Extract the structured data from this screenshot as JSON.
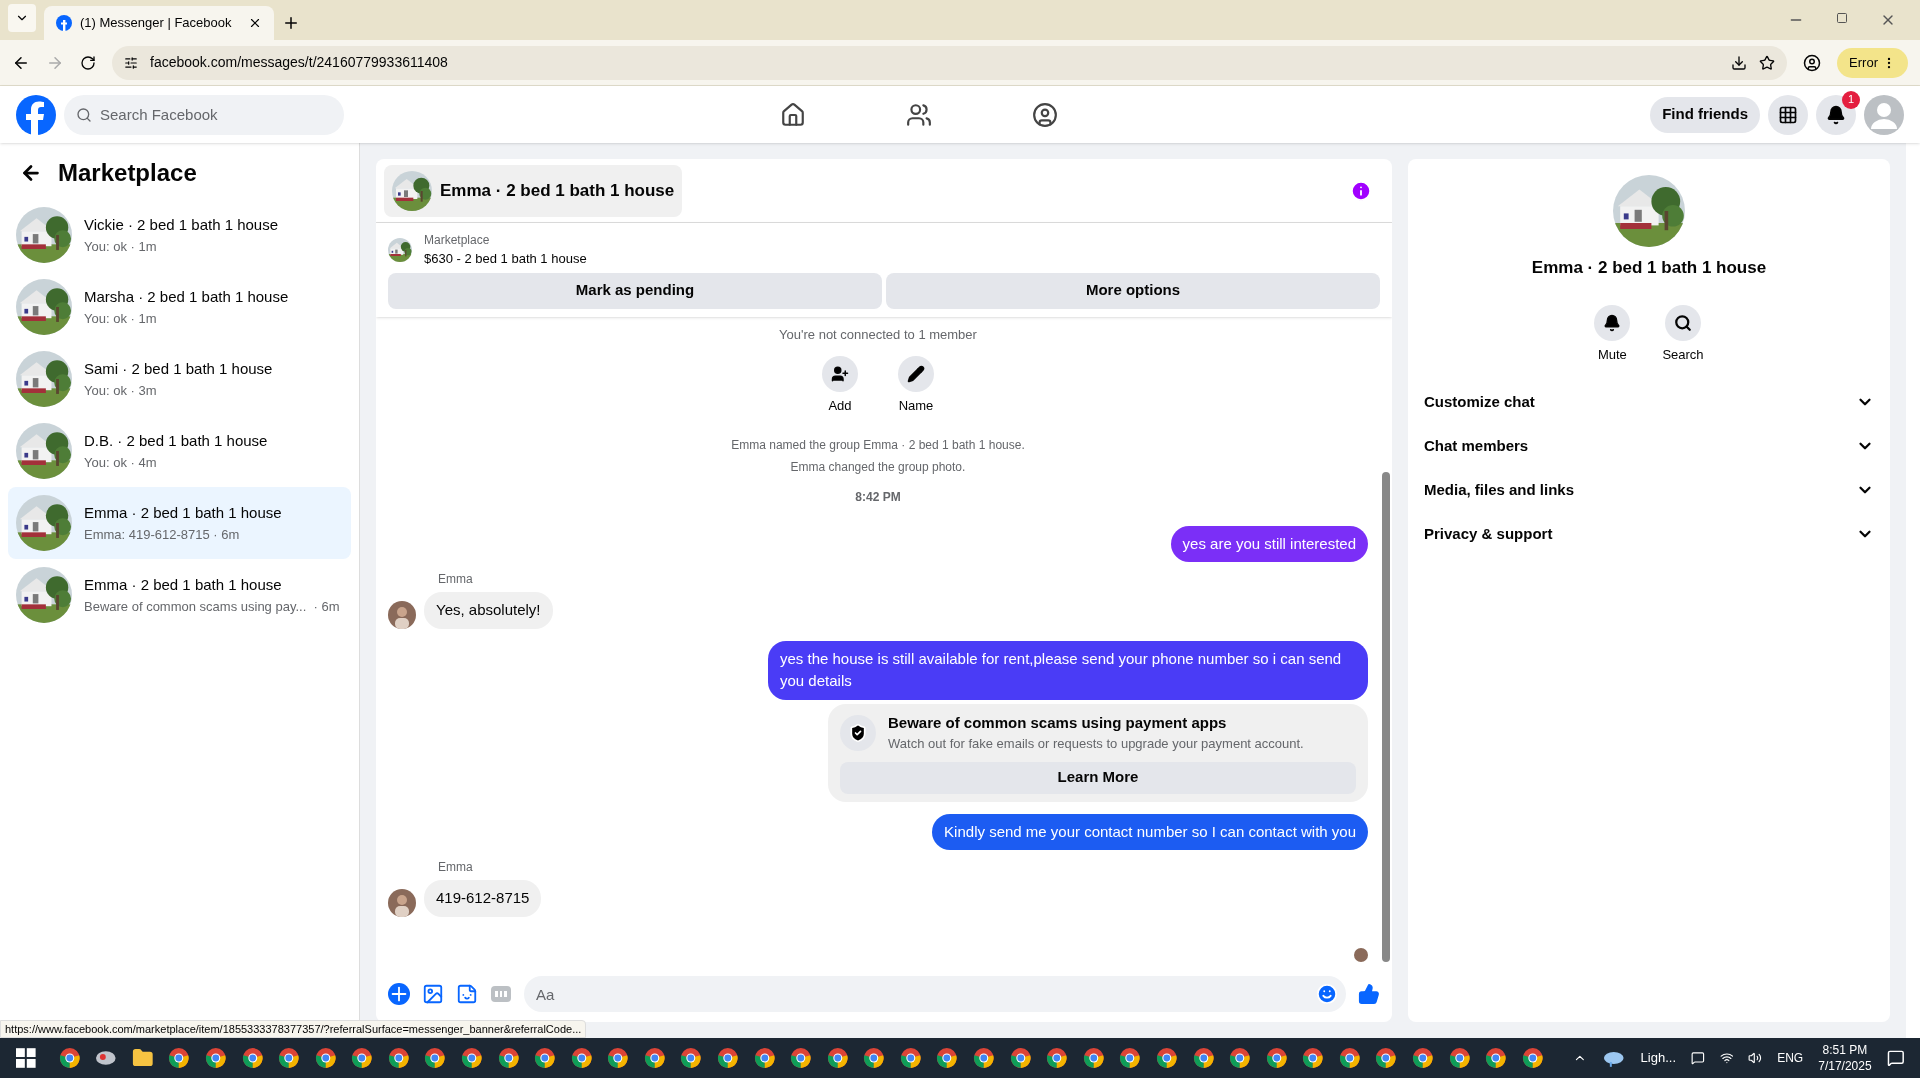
{
  "browser": {
    "tab_title": "(1) Messenger | Facebook",
    "url": "facebook.com/messages/t/24160779933611408",
    "profile_button": "Error"
  },
  "header": {
    "search": {
      "placeholder": "Search Facebook"
    },
    "find_friends": "Find friends",
    "notification_count": "1"
  },
  "sidebar": {
    "title": "Marketplace",
    "conversations": [
      {
        "name": "Vickie · 2 bed 1 bath 1 house",
        "preview": "You: ok · 1m",
        "selected": false
      },
      {
        "name": "Marsha · 2 bed 1 bath 1 house",
        "preview": "You: ok · 1m",
        "selected": false
      },
      {
        "name": "Sami · 2 bed 1 bath 1 house",
        "preview": "You: ok · 3m",
        "selected": false
      },
      {
        "name": "D.B. · 2 bed 1 bath 1 house",
        "preview": "You: ok · 4m",
        "selected": false
      },
      {
        "name": "Emma · 2 bed 1 bath 1 house",
        "preview": "Emma: 419-612-8715 · 6m",
        "selected": true
      },
      {
        "name": "Emma · 2 bed 1 bath 1 house",
        "preview": "Beware of common scams using pay...  · 6m",
        "selected": false
      }
    ]
  },
  "chat": {
    "title": "Emma · 2 bed 1 bath 1 house",
    "listing": {
      "label": "Marketplace",
      "title": "$630 - 2 bed 1 bath 1 house"
    },
    "buttons": [
      "Mark as pending",
      "More options"
    ],
    "group_note": "You're not connected to 1 member",
    "group_actions": [
      "Add",
      "Name"
    ],
    "messages": [
      {
        "kind": "note",
        "text": "Emma named the group Emma · 2 bed 1 bath 1 house."
      },
      {
        "kind": "note",
        "text": "Emma changed the group photo."
      },
      {
        "kind": "time",
        "text": "8:42 PM"
      },
      {
        "kind": "outgoing",
        "text": "yes are you still interested",
        "color": "#7b2ff7"
      },
      {
        "kind": "incoming",
        "sender": "Emma",
        "text": "Yes, absolutely!"
      },
      {
        "kind": "outgoing",
        "text": "yes the house is still available for rent,please send your  phone number so i can send you details",
        "color": "#4a3cf6"
      },
      {
        "kind": "warning",
        "title": "Beware of common scams using payment apps",
        "text": "Watch out for fake emails or requests to upgrade your payment account.",
        "button": "Learn More"
      },
      {
        "kind": "outgoing",
        "text": "Kindly send me your contact number so I can contact with you",
        "color": "#1c5cf2"
      },
      {
        "kind": "incoming",
        "sender": "Emma",
        "text": "419-612-8715"
      }
    ],
    "composer": {
      "placeholder": "Aa"
    }
  },
  "details": {
    "title": "Emma · 2 bed 1 bath 1 house",
    "actions": [
      "Mute",
      "Search"
    ],
    "sections": [
      {
        "label": "Customize chat",
        "expanded": false
      },
      {
        "label": "Chat members",
        "expanded": false
      },
      {
        "label": "Media, files and links",
        "expanded": false
      },
      {
        "label": "Privacy & support",
        "expanded": false
      }
    ]
  },
  "status_url": "https://www.facebook.com/marketplace/item/1855333378377357/?referralSurface=messenger_banner&referralCode...",
  "taskbar": {
    "weather": "Ligh...",
    "language": "ENG",
    "time": "8:51 PM",
    "date": "7/17/2025"
  }
}
